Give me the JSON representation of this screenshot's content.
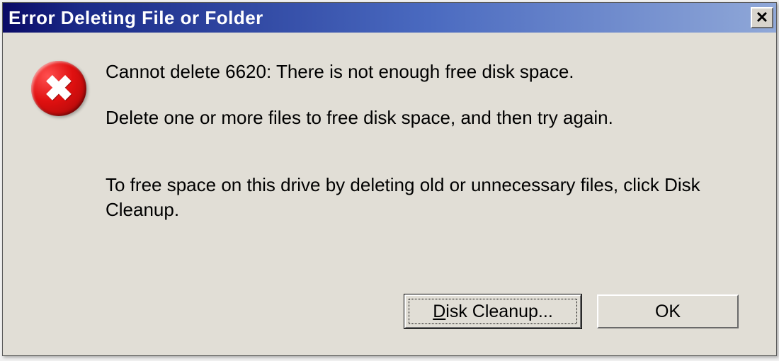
{
  "dialog": {
    "title": "Error Deleting File or Folder",
    "messages": {
      "line1": "Cannot delete 6620: There is not enough free disk space.",
      "line2": "Delete one or more files to free disk space, and then try again.",
      "line3": "To free space on this drive by deleting old or unnecessary files, click Disk Cleanup."
    },
    "buttons": {
      "disk_cleanup_prefix": "D",
      "disk_cleanup_rest": "isk Cleanup...",
      "ok": "OK"
    },
    "icon": "error-icon"
  }
}
